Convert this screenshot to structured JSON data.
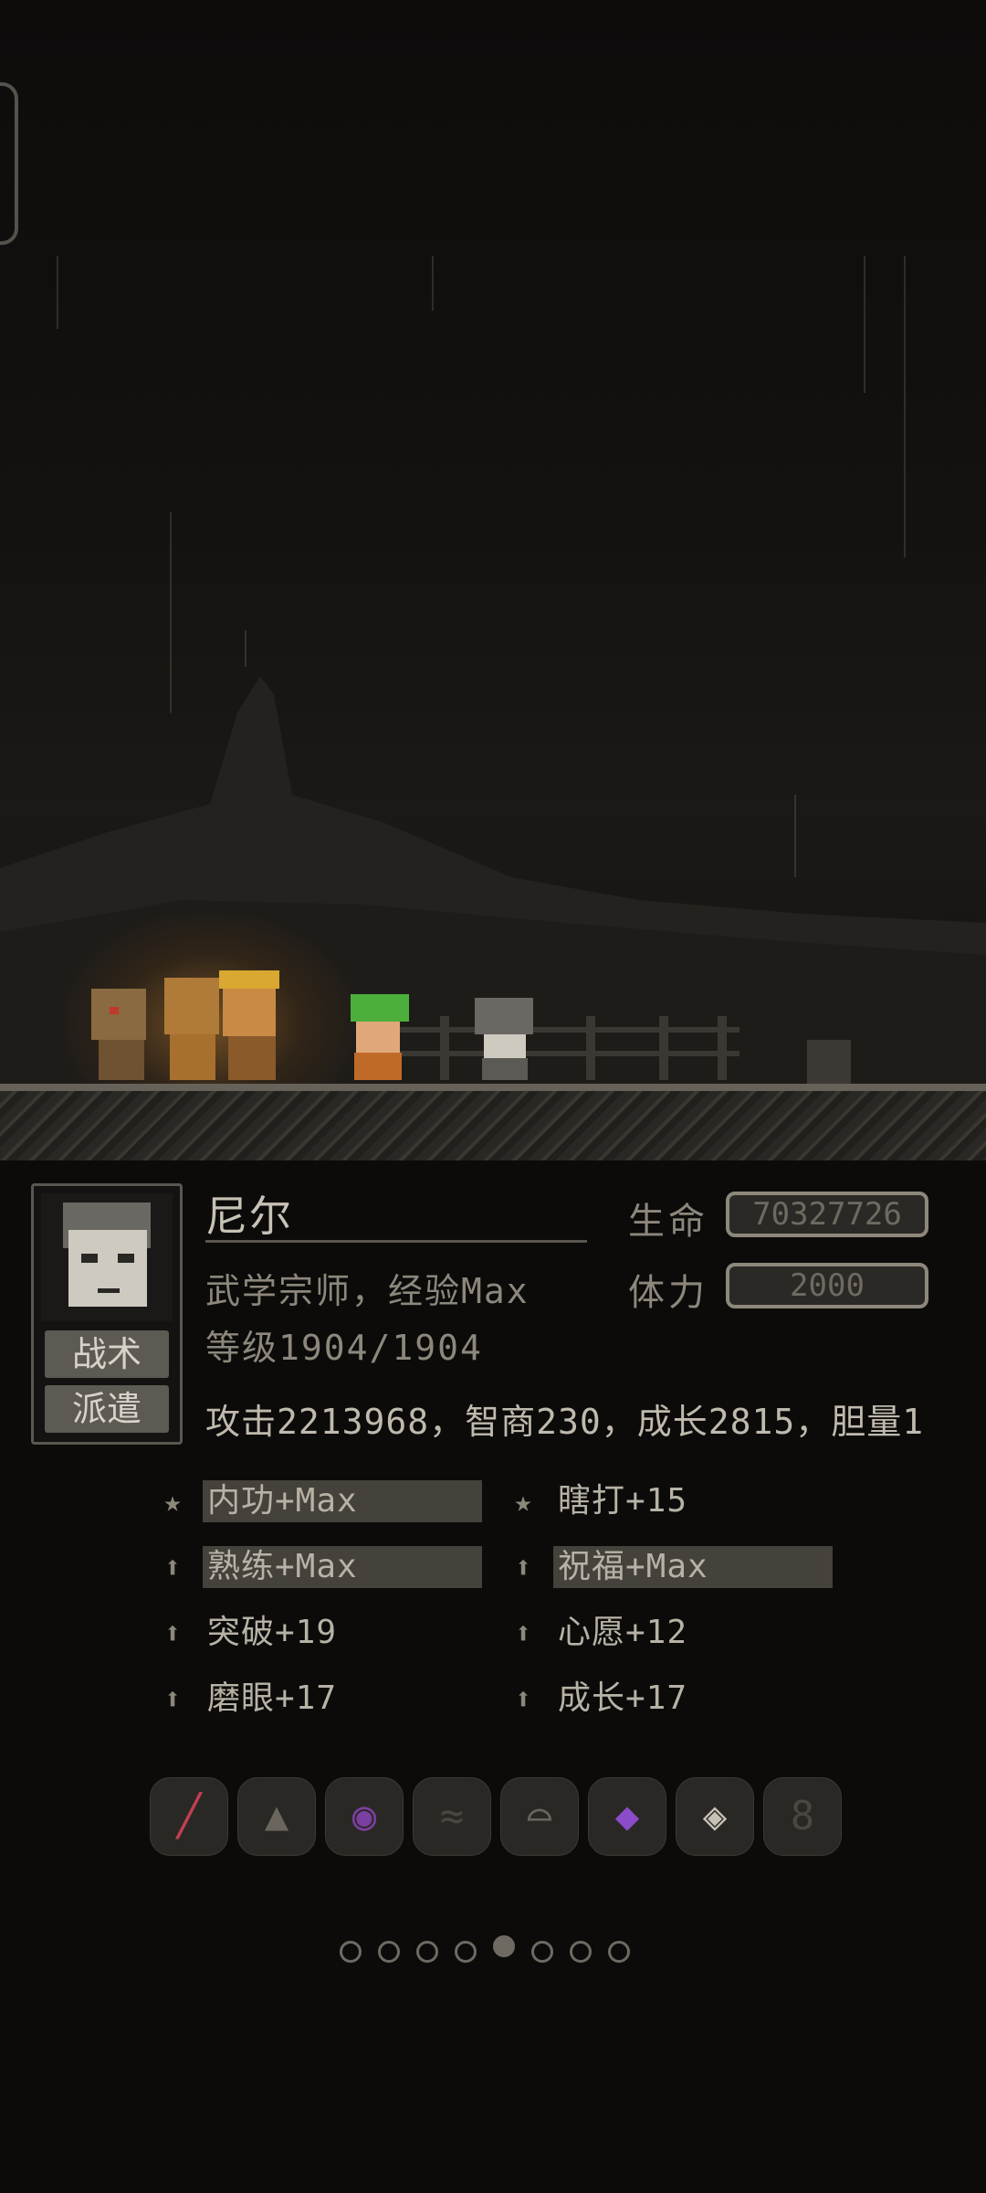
{
  "character": {
    "name": "尼尔",
    "title": "武学宗师，经验Max",
    "level": "等级1904/1904",
    "attributes": "攻击2213968，智商230，成长2815，胆量1"
  },
  "stats": {
    "hp_label": "生命",
    "hp_value": "70327726",
    "stamina_label": "体力",
    "stamina_value": "2000"
  },
  "portrait_buttons": {
    "tactics": "战术",
    "dispatch": "派遣"
  },
  "skills": [
    {
      "icon": "star-icon",
      "text": "内功+Max",
      "highlight": true
    },
    {
      "icon": "star-icon",
      "text": "瞎打+15",
      "highlight": false
    },
    {
      "icon": "arrow-up-icon",
      "text": "熟练+Max",
      "highlight": true
    },
    {
      "icon": "arrow-up-icon",
      "text": "祝福+Max",
      "highlight": true
    },
    {
      "icon": "arrow-up-icon",
      "text": "突破+19",
      "highlight": false
    },
    {
      "icon": "arrow-up-icon",
      "text": "心愿+12",
      "highlight": false
    },
    {
      "icon": "arrow-up-icon",
      "text": "磨眼+17",
      "highlight": false
    },
    {
      "icon": "arrow-up-icon",
      "text": "成长+17",
      "highlight": false
    }
  ],
  "equipment": [
    {
      "name": "sword-icon",
      "color": "#c04050"
    },
    {
      "name": "hat-icon",
      "color": "#6a665e"
    },
    {
      "name": "amulet-icon",
      "color": "#7a3fa0"
    },
    {
      "name": "cloak-icon",
      "color": "#4a4640"
    },
    {
      "name": "jellyfish-icon",
      "color": "#6a665e"
    },
    {
      "name": "gem-icon",
      "color": "#8a4cc8"
    },
    {
      "name": "ring-icon",
      "color": "#c8c2b6"
    },
    {
      "name": "gourd-icon",
      "color": "#4a4640"
    }
  ],
  "pagination": {
    "count": 8,
    "active": 4
  },
  "colors": {
    "panel_bg": "#0c0b0a",
    "accent": "#8d877c",
    "skill_highlight": "#45413b"
  }
}
